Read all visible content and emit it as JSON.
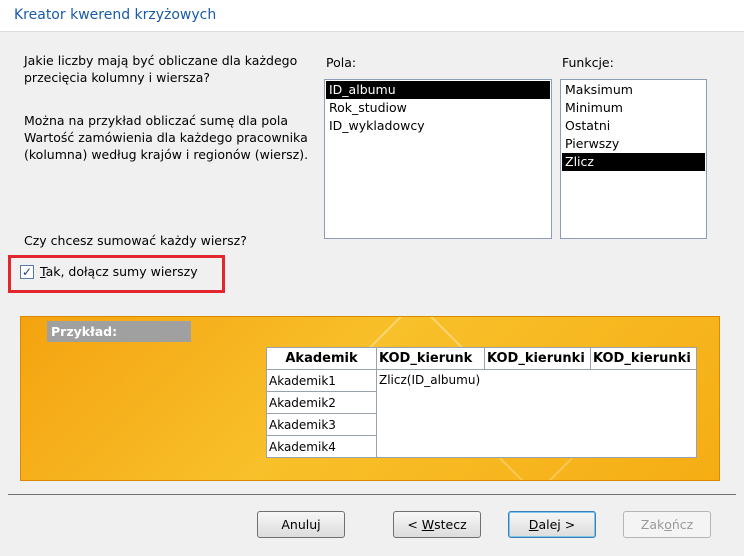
{
  "window": {
    "title": "Kreator kwerend krzyżowych"
  },
  "instructions": {
    "question": "Jakie liczby mają być obliczane dla każdego przecięcia kolumny i wiersza?",
    "example_text": "Można na przykład obliczać sumę dla pola Wartość zamówienia dla każdego pracownika (kolumna) według krajów i regionów (wiersz).",
    "row_sum_question": "Czy chcesz sumować każdy wiersz?"
  },
  "row_sum_checkbox": {
    "checked": true,
    "mnemonic": "T",
    "label_rest": "ak, dołącz sumy wierszy"
  },
  "fields_list": {
    "label": "Pola:",
    "items": [
      "ID_albumu",
      "Rok_studiow",
      "ID_wykladowcy"
    ],
    "selected": "ID_albumu"
  },
  "functions_list": {
    "label": "Funkcje:",
    "items": [
      "Maksimum",
      "Minimum",
      "Ostatni",
      "Pierwszy",
      "Zlicz"
    ],
    "selected": "Zlicz"
  },
  "preview": {
    "label": "Przykład:",
    "headers": [
      "Akademik",
      "KOD_kierunk",
      "KOD_kierunki",
      "KOD_kierunki"
    ],
    "rows": [
      "Akademik1",
      "Akademik2",
      "Akademik3",
      "Akademik4"
    ],
    "cell_value": "Zlicz(ID_albumu)"
  },
  "buttons": {
    "cancel": "Anuluj",
    "back_prefix": "< ",
    "back_mnemonic": "W",
    "back_rest": "stecz",
    "next_mnemonic": "D",
    "next_rest": "alej >",
    "finish_pre": "Zak",
    "finish_mnemonic": "o",
    "finish_rest": "ńcz"
  },
  "colors": {
    "highlight": "#e3262e",
    "title": "#1a5aa8",
    "preview_bg": "#f7ae12"
  }
}
